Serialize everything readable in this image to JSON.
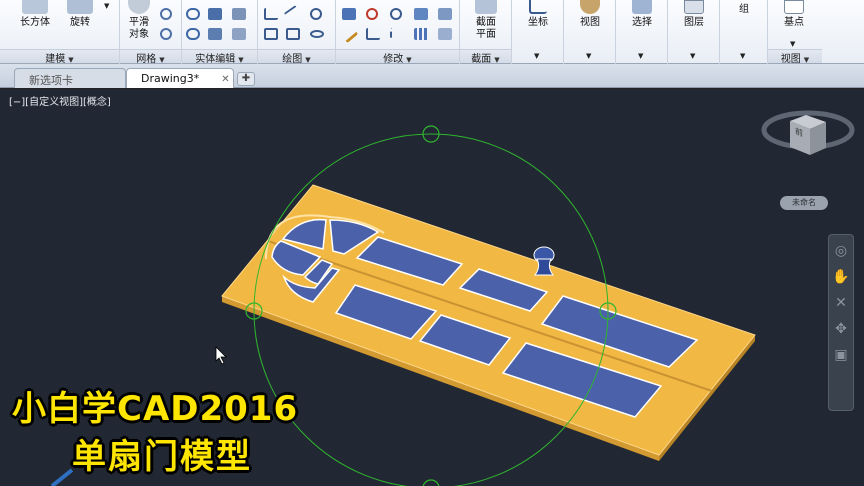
{
  "ribbon": {
    "panels": [
      {
        "title": "建模",
        "buttons": [
          "长方体",
          "旋转"
        ]
      },
      {
        "title": "网格",
        "buttons": [
          "平滑",
          "对象"
        ]
      },
      {
        "title": "实体编辑"
      },
      {
        "title": "绘图"
      },
      {
        "title": "修改"
      },
      {
        "title": "截面",
        "buttons": [
          "截面",
          "平面"
        ]
      },
      {
        "title": "",
        "buttons": [
          "坐标"
        ]
      },
      {
        "title": "",
        "buttons": [
          "视图"
        ]
      },
      {
        "title": "",
        "buttons": [
          "选择"
        ]
      },
      {
        "title": "",
        "buttons": [
          "图层"
        ]
      },
      {
        "title": "",
        "buttons": [
          "组"
        ]
      },
      {
        "title": "视图",
        "buttons": [
          "基点"
        ]
      }
    ]
  },
  "tabs": [
    {
      "label": "新选项卡",
      "active": false
    },
    {
      "label": "Drawing3*",
      "active": true
    }
  ],
  "viewport": {
    "label": "[−][自定义视图][概念]",
    "wcs": "未命名",
    "cube_face": "前"
  },
  "overlay": {
    "line1": "小白学CAD2016",
    "line2": "单扇门模型"
  },
  "colors": {
    "viewport_bg": "#222833",
    "door_wood": "#f1b843",
    "door_glass": "#4b61aa",
    "gizmo": "#2fb52f",
    "caption": "#ffe600"
  }
}
